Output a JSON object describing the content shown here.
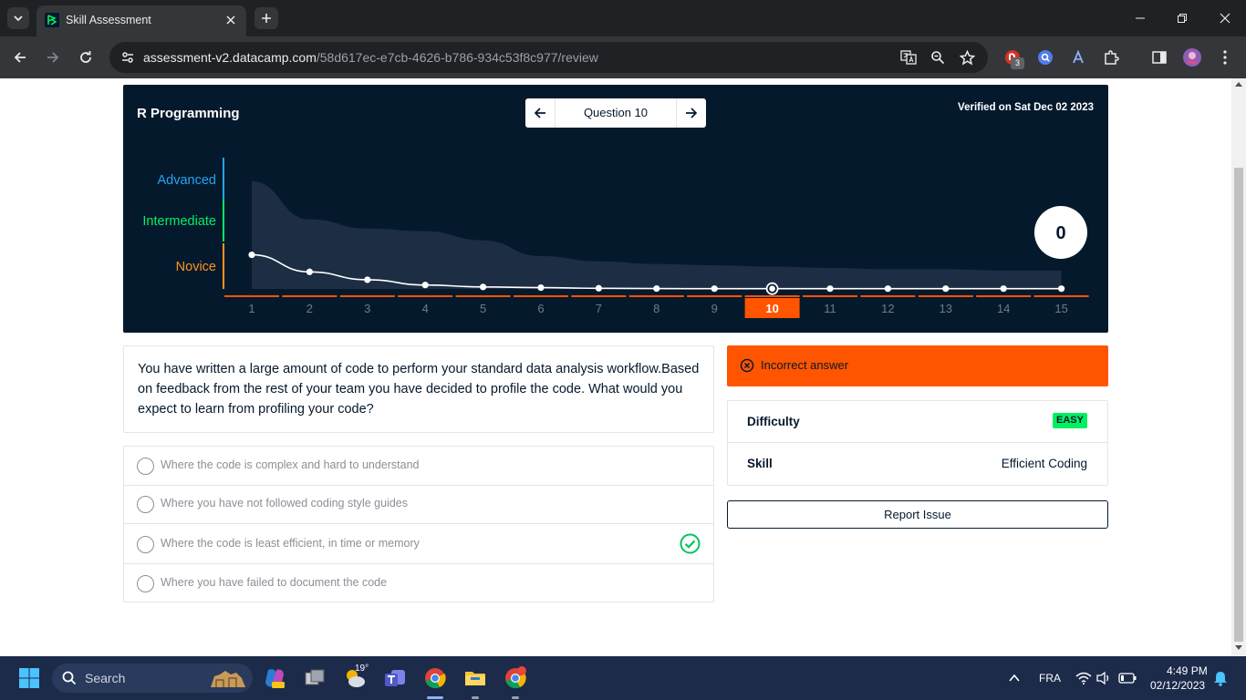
{
  "browser": {
    "tab_title": "Skill Assessment",
    "url_host": "assessment-v2.datacamp.com",
    "url_path": "/58d617ec-e7cb-4626-b786-934c53f8c977/review",
    "extension_badge": "3"
  },
  "assessment": {
    "skill_name": "R Programming",
    "question_label": "Question 10",
    "verified": "Verified on Sat Dec 02 2023",
    "score": "0"
  },
  "chart_data": {
    "type": "line",
    "levels": [
      "Advanced",
      "Intermediate",
      "Novice"
    ],
    "level_colors": [
      "#23a6f0",
      "#03ef62",
      "#ff931e"
    ],
    "x": [
      "1",
      "2",
      "3",
      "4",
      "5",
      "6",
      "7",
      "8",
      "9",
      "10",
      "11",
      "12",
      "13",
      "14",
      "15"
    ],
    "current_question": "10",
    "series": [
      {
        "values": [
          0.26,
          0.13,
          0.07,
          0.03,
          0.015,
          0.01,
          0.005,
          0.003,
          0.002,
          0.002,
          0.002,
          0.002,
          0.002,
          0.002,
          0.002
        ]
      }
    ],
    "confidence_band_upper": [
      0.82,
      0.53,
      0.46,
      0.44,
      0.37,
      0.25,
      0.21,
      0.19,
      0.18,
      0.17,
      0.16,
      0.15,
      0.15,
      0.14,
      0.14
    ],
    "ylim": [
      0,
      1
    ]
  },
  "question": {
    "text": "You have written a large amount of code to perform your standard data analysis workflow.Based on feedback from the rest of your team you have decided to profile the code. What would you expect to learn from profiling your code?",
    "options": [
      {
        "label": "Where the code is complex and hard to understand",
        "correct": false
      },
      {
        "label": "Where you have not followed coding style guides",
        "correct": false
      },
      {
        "label": "Where the code is least efficient, in time or memory",
        "correct": true
      },
      {
        "label": "Where you have failed to document the code",
        "correct": false
      }
    ]
  },
  "result": {
    "label": "Incorrect answer",
    "color": "#ff5400"
  },
  "meta": {
    "difficulty_key": "Difficulty",
    "difficulty_val": "EASY",
    "skill_key": "Skill",
    "skill_val": "Efficient Coding"
  },
  "report_label": "Report Issue",
  "taskbar": {
    "search_label": "Search",
    "weather_temp": "19°",
    "language": "FRA",
    "time": "4:49 PM",
    "date": "02/12/2023"
  }
}
